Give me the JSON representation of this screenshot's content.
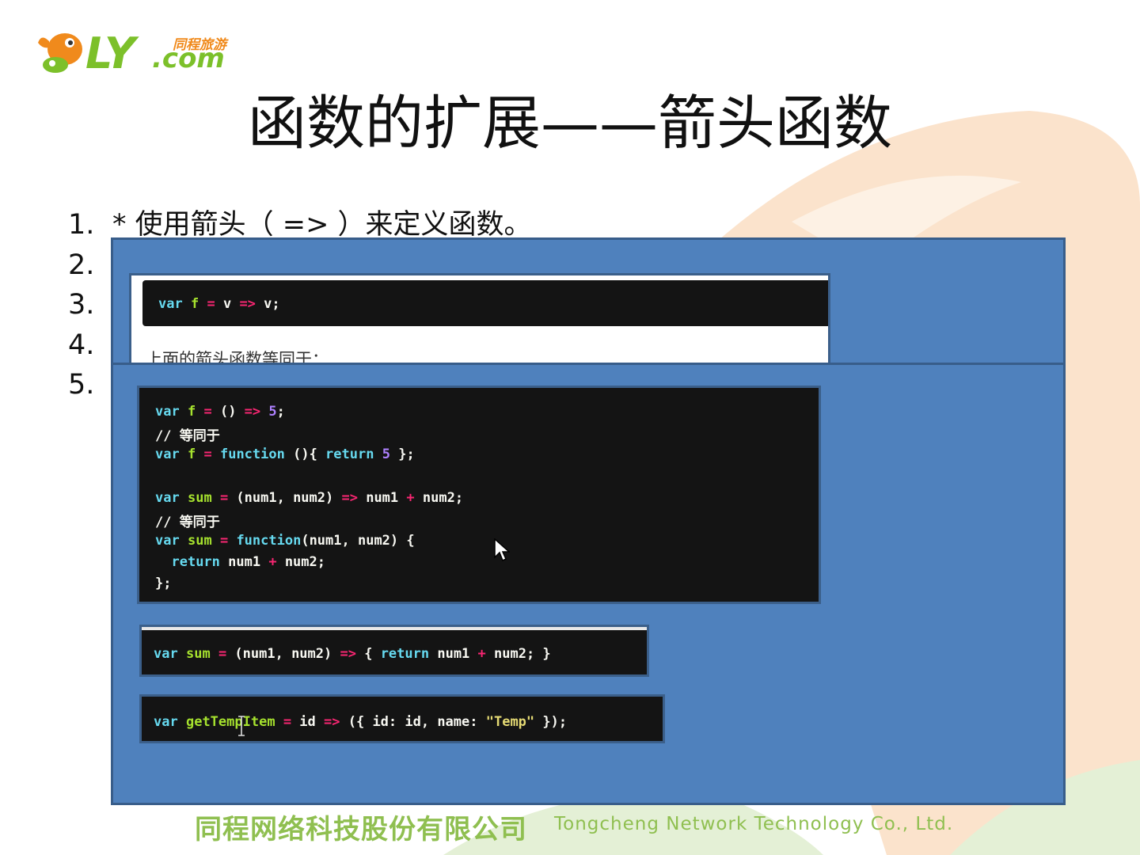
{
  "logo": {
    "brand_text": "LY",
    "domain_text": ".com",
    "cn_text": "同程旅游"
  },
  "slide": {
    "title": "函数的扩展——箭头函数"
  },
  "bullets": [
    {
      "num": "1.",
      "text": "* 使用箭头（ => ）来定义函数。"
    },
    {
      "num": "2.",
      "text": ""
    },
    {
      "num": "3.",
      "text": ""
    },
    {
      "num": "4.",
      "text": ""
    },
    {
      "num": "5.",
      "text": ""
    }
  ],
  "snippet_top": {
    "code": "var f = v => v;",
    "note": "上面的箭头函数等同于："
  },
  "snippet_big": {
    "lines": [
      "var f = () => 5;",
      "// 等同于",
      "var f = function (){ return 5 };",
      "",
      "var sum = (num1, num2) => num1 + num2;",
      "// 等同于",
      "var sum = function(num1, num2) {",
      "  return num1 + num2;",
      "};"
    ]
  },
  "snippet_sum": {
    "code": "var sum = (num1, num2) => { return num1 + num2; }"
  },
  "snippet_temp": {
    "code": "var getTempItem = id => ({ id: id, name: \"Temp\" });"
  },
  "footer": {
    "company_cn": "同程网络科技股份有限公司",
    "company_en": "Tongcheng Network Technology Co., Ltd."
  },
  "colors": {
    "panel_blue": "#4f81bd",
    "brand_green": "#7cc02a",
    "brand_orange": "#f08a1c",
    "code_bg": "#141414"
  },
  "icons": [
    "mouse-pointer-icon",
    "text-cursor-icon",
    "fish-logo-icon"
  ]
}
